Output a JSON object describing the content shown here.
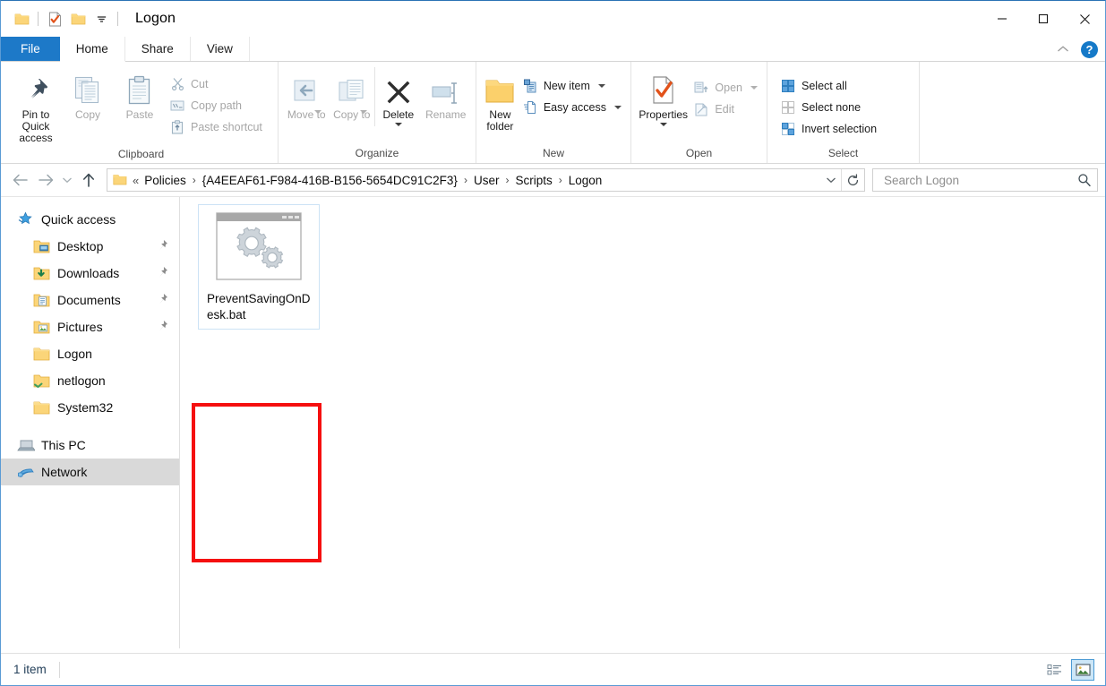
{
  "window": {
    "title": "Logon",
    "quick_access_toolbar": [
      {
        "name": "folder-icon",
        "label": "Folder"
      },
      {
        "name": "properties-icon",
        "label": "Properties"
      },
      {
        "name": "new-folder-icon",
        "label": "New folder"
      },
      {
        "name": "customize-dropdown-icon",
        "label": "Customize Quick Access Toolbar"
      }
    ],
    "controls": {
      "minimize": "Minimize",
      "maximize": "Maximize",
      "close": "Close"
    }
  },
  "tabs": [
    {
      "label": "File",
      "id": "file"
    },
    {
      "label": "Home",
      "id": "home"
    },
    {
      "label": "Share",
      "id": "share"
    },
    {
      "label": "View",
      "id": "view"
    }
  ],
  "tabstrip_right": {
    "collapse_ribbon": "Minimize the Ribbon",
    "help": "?"
  },
  "ribbon": {
    "groups": [
      {
        "label": "Clipboard",
        "big_buttons": [
          {
            "label": "Pin to Quick access",
            "icon": "pin-icon",
            "disabled": false
          },
          {
            "label": "Copy",
            "icon": "copy-icon",
            "disabled": true
          },
          {
            "label": "Paste",
            "icon": "paste-icon",
            "disabled": true
          }
        ],
        "small_buttons": [
          {
            "label": "Cut",
            "icon": "scissors-icon",
            "disabled": true
          },
          {
            "label": "Copy path",
            "icon": "copy-path-icon",
            "disabled": true
          },
          {
            "label": "Paste shortcut",
            "icon": "paste-shortcut-icon",
            "disabled": true
          }
        ]
      },
      {
        "label": "Organize",
        "big_buttons": [
          {
            "label": "Move to",
            "icon": "move-to-icon",
            "disabled": true,
            "caret": true
          },
          {
            "label": "Copy to",
            "icon": "copy-to-icon",
            "disabled": true,
            "caret": true
          },
          {
            "label": "Delete",
            "icon": "delete-icon",
            "disabled": false,
            "caret": true
          },
          {
            "label": "Rename",
            "icon": "rename-icon",
            "disabled": true
          }
        ]
      },
      {
        "label": "New",
        "big_buttons": [
          {
            "label": "New folder",
            "icon": "new-folder-icon",
            "disabled": false
          }
        ],
        "small_buttons": [
          {
            "label": "New item",
            "icon": "new-item-icon",
            "disabled": false,
            "caret": true
          },
          {
            "label": "Easy access",
            "icon": "easy-access-icon",
            "disabled": false,
            "caret": true
          }
        ]
      },
      {
        "label": "Open",
        "big_buttons": [
          {
            "label": "Properties",
            "icon": "properties-icon",
            "disabled": false,
            "caret": true
          }
        ],
        "small_buttons": [
          {
            "label": "Open",
            "icon": "open-icon",
            "disabled": true,
            "caret": true
          },
          {
            "label": "Edit",
            "icon": "edit-icon",
            "disabled": true
          }
        ]
      },
      {
        "label": "Select",
        "small_buttons": [
          {
            "label": "Select all",
            "icon": "select-all-icon",
            "disabled": false
          },
          {
            "label": "Select none",
            "icon": "select-none-icon",
            "disabled": false
          },
          {
            "label": "Invert selection",
            "icon": "invert-selection-icon",
            "disabled": false
          }
        ]
      }
    ]
  },
  "address_bar": {
    "back": "Back",
    "forward": "Forward",
    "recent": "Recent locations",
    "up": "Up",
    "breadcrumbs": [
      "Policies",
      "{A4EEAF61-F984-416B-B156-5654DC91C2F3}",
      "User",
      "Scripts",
      "Logon"
    ],
    "overflow_chevron": "«",
    "separator": "›",
    "dropdown": "Previous locations",
    "refresh": "Refresh",
    "search": {
      "placeholder": "Search Logon",
      "value": "",
      "icon": "search-icon"
    }
  },
  "nav_pane": {
    "items": [
      {
        "label": "Quick access",
        "icon": "quick-access-star-icon",
        "indent": false,
        "pinned": false,
        "selected": false
      },
      {
        "label": "Desktop",
        "icon": "desktop-folder-icon",
        "indent": true,
        "pinned": true,
        "selected": false
      },
      {
        "label": "Downloads",
        "icon": "downloads-folder-icon",
        "indent": true,
        "pinned": true,
        "selected": false
      },
      {
        "label": "Documents",
        "icon": "documents-folder-icon",
        "indent": true,
        "pinned": true,
        "selected": false
      },
      {
        "label": "Pictures",
        "icon": "pictures-folder-icon",
        "indent": true,
        "pinned": true,
        "selected": false
      },
      {
        "label": "Logon",
        "icon": "folder-icon",
        "indent": true,
        "pinned": false,
        "selected": false
      },
      {
        "label": "netlogon",
        "icon": "network-folder-icon",
        "indent": true,
        "pinned": false,
        "selected": false
      },
      {
        "label": "System32",
        "icon": "folder-icon",
        "indent": true,
        "pinned": false,
        "selected": false
      },
      {
        "label": "This PC",
        "icon": "this-pc-icon",
        "indent": false,
        "pinned": false,
        "selected": false,
        "gap_before": true
      },
      {
        "label": "Network",
        "icon": "network-icon",
        "indent": false,
        "pinned": false,
        "selected": true
      }
    ]
  },
  "file_pane": {
    "items": [
      {
        "name": "PreventSavingOnDesk.bat",
        "icon": "bat-script-icon",
        "selected": true
      }
    ],
    "annotation": {
      "color": "#f50f0f",
      "shape": "rectangle"
    }
  },
  "status_bar": {
    "item_count": "1 item",
    "views": [
      {
        "name": "details-view-button",
        "label": "Details view",
        "active": false
      },
      {
        "name": "large-icons-view-button",
        "label": "Large icons view",
        "active": true
      }
    ]
  },
  "colors": {
    "accent": "#1d79c8",
    "annotation": "#f50f0f",
    "selection": "#cce3f5",
    "nav_selected": "#d9d9d9"
  }
}
